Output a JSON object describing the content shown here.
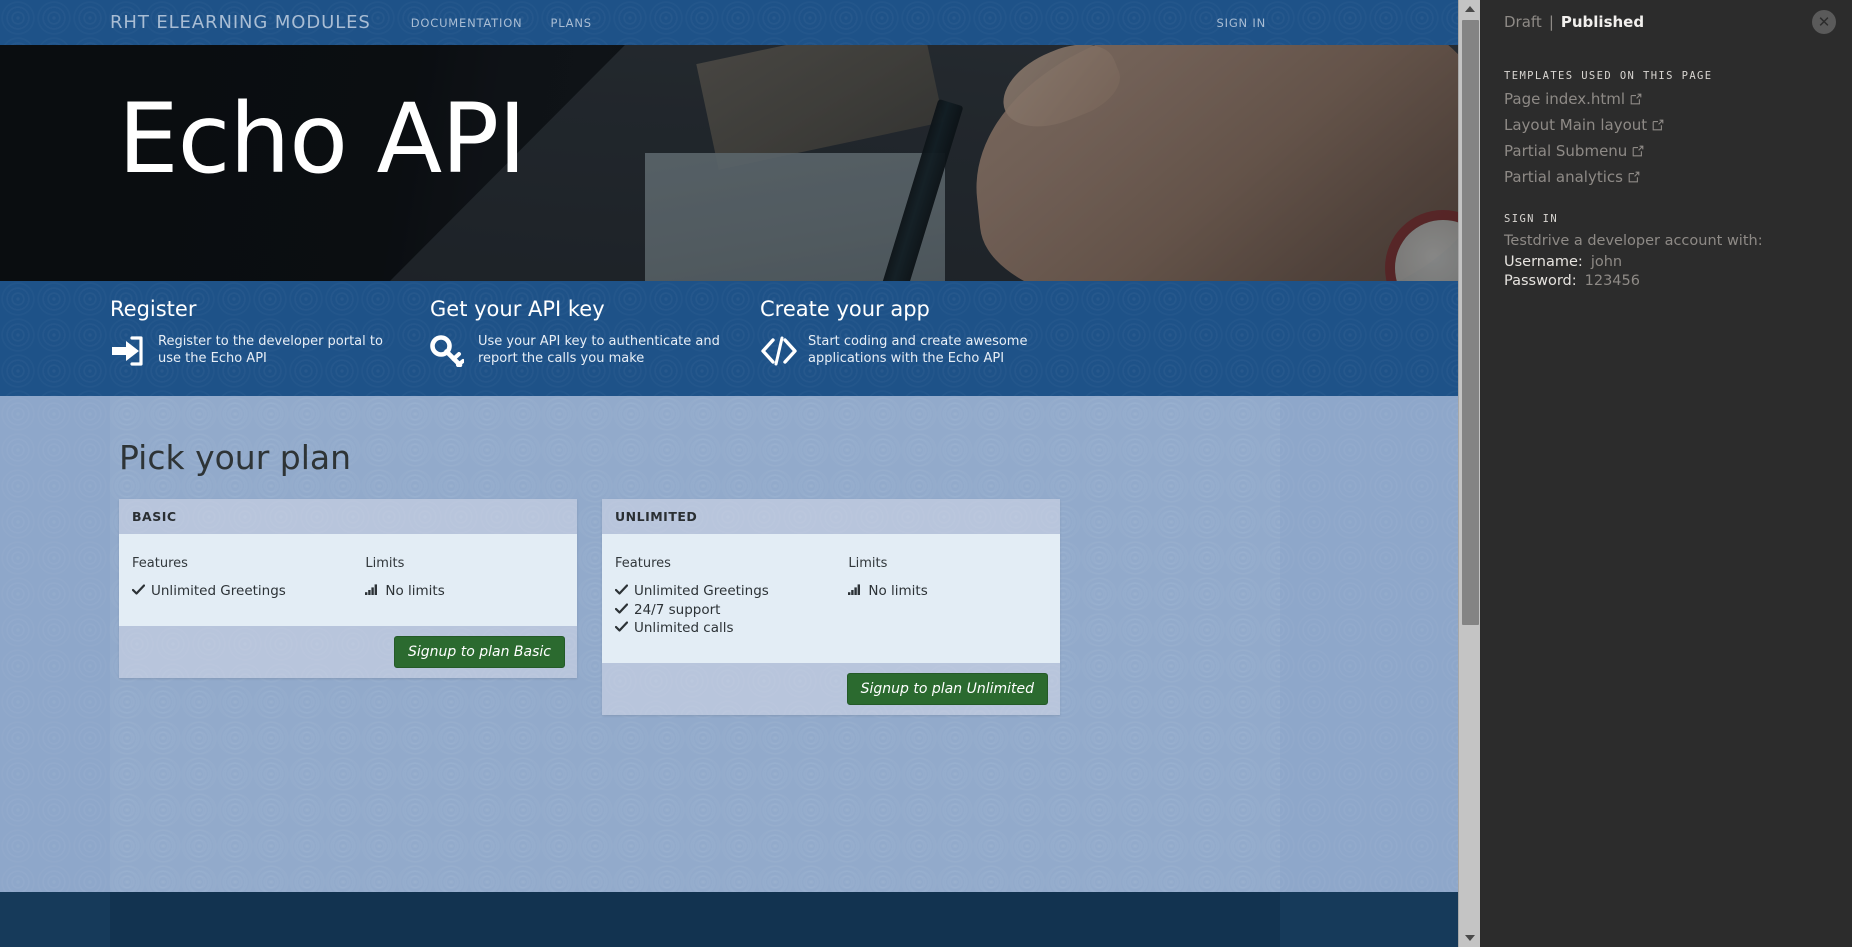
{
  "navbar": {
    "brand": "RHT ELEARNING MODULES",
    "links": [
      {
        "label": "DOCUMENTATION",
        "name": "nav-link-documentation"
      },
      {
        "label": "PLANS",
        "name": "nav-link-plans"
      }
    ],
    "signin_label": "SIGN IN"
  },
  "hero": {
    "title": "Echo API"
  },
  "features": [
    {
      "title": "Register",
      "text": "Register to the developer portal to use the Echo API",
      "icon": "sign-in-arrow-icon"
    },
    {
      "title": "Get your API key",
      "text": "Use your API key to authenticate and report the calls you make",
      "icon": "key-icon"
    },
    {
      "title": "Create your app",
      "text": "Start coding and create awesome applications with the Echo API",
      "icon": "code-brackets-icon"
    }
  ],
  "plans": {
    "heading": "Pick your plan",
    "features_column_header": "Features",
    "limits_column_header": "Limits",
    "cards": [
      {
        "name": "BASIC",
        "features": [
          "Unlimited Greetings"
        ],
        "limits": [
          "No limits"
        ],
        "button_label": "Signup to plan Basic",
        "feature_icon": "check-icon",
        "limit_icon": "signal-bars-icon"
      },
      {
        "name": "UNLIMITED",
        "features": [
          "Unlimited Greetings",
          "24/7 support",
          "Unlimited calls"
        ],
        "limits": [
          "No limits"
        ],
        "button_label": "Signup to plan Unlimited",
        "feature_icon": "check-icon",
        "limit_icon": "signal-bars-icon"
      }
    ]
  },
  "inspector": {
    "status": {
      "draft_label": "Draft",
      "separator": "|",
      "published_label": "Published"
    },
    "close_label": "✕",
    "templates": {
      "section_title": "TEMPLATES USED ON THIS PAGE",
      "items": [
        {
          "label": "Page index.html"
        },
        {
          "label": "Layout Main layout"
        },
        {
          "label": "Partial Submenu"
        },
        {
          "label": "Partial analytics"
        }
      ]
    },
    "signin": {
      "section_title": "SIGN IN",
      "note": "Testdrive a developer account with:",
      "username_label": "Username:",
      "username_value": "john",
      "password_label": "Password:",
      "password_value": "123456"
    }
  },
  "colors": {
    "nav_blue": "#1e5288",
    "band_blue": "#1e5288",
    "page_blue": "#8ea7ca",
    "card_body": "#e3edf5",
    "card_head": "#b8c5dc",
    "button_green": "#2b6a2f",
    "footer_navy": "#163a5a",
    "panel_dark": "#2c2c2c"
  }
}
